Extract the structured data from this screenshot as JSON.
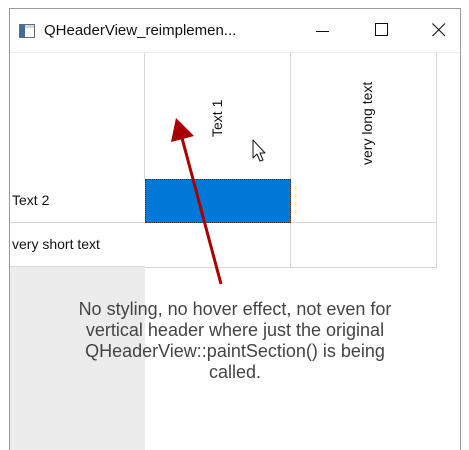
{
  "window": {
    "title": "QHeaderView_reimplemen...",
    "icons": {
      "app": "app-window-icon",
      "minimize": "minimize-icon",
      "maximize": "maximize-icon",
      "close": "close-icon"
    }
  },
  "table": {
    "horizontal_headers": [
      "Text 1",
      "very long text"
    ],
    "vertical_headers": [
      "Text 2",
      "very short text"
    ],
    "selected_cell": {
      "row": 0,
      "column": 0
    },
    "colors": {
      "selection": "#0078d7",
      "header_background": "#ffffff",
      "empty_area": "#ececec"
    }
  },
  "annotation": {
    "text": "No styling, no hover effect, not even for\nvertical header where just the original\nQHeaderView::paintSection() is being\ncalled.",
    "arrow_color": "#a80000"
  }
}
